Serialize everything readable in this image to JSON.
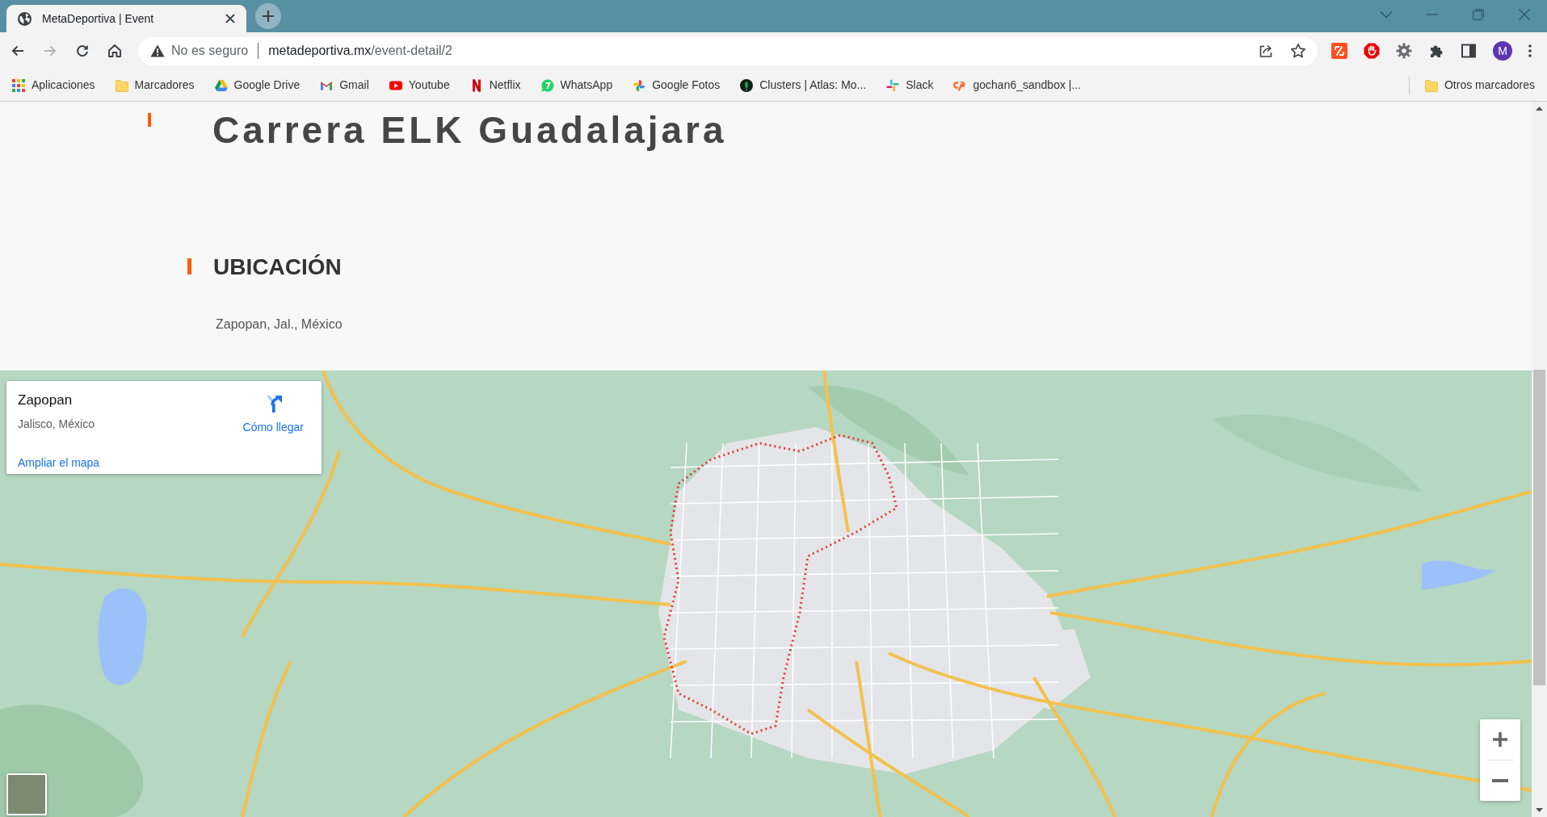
{
  "browser": {
    "tabs": [
      {
        "title": "MetaDeportiva | Event",
        "selected": true
      }
    ],
    "toolbar": {
      "nav": [
        {
          "kind": "back",
          "disabled": false
        },
        {
          "kind": "forward",
          "disabled": true
        },
        {
          "kind": "reload",
          "disabled": false
        },
        {
          "kind": "home",
          "disabled": false
        }
      ],
      "security_label": "No es seguro",
      "url_host": "metadeportiva.mx",
      "url_path": "/event-detail/2",
      "profile_initial": "M"
    },
    "bookmarks": [
      {
        "label": "Aplicaciones",
        "kind": "apps"
      },
      {
        "label": "Marcadores",
        "kind": "folder"
      },
      {
        "label": "Google Drive",
        "kind": "drive"
      },
      {
        "label": "Gmail",
        "kind": "mail"
      },
      {
        "label": "Youtube",
        "kind": "video"
      },
      {
        "label": "Netflix",
        "kind": "netflix"
      },
      {
        "label": "WhatsApp",
        "kind": "chat"
      },
      {
        "label": "Google Fotos",
        "kind": "pinwheel"
      },
      {
        "label": "Clusters | Atlas: Mo...",
        "kind": "leaf"
      },
      {
        "label": "Slack",
        "kind": "slack"
      },
      {
        "label": "gochan6_sandbox |...",
        "kind": "cpanel"
      }
    ],
    "other_bookmarks": {
      "label": "Otros marcadores",
      "kind": "folder"
    }
  },
  "page": {
    "title": "Carrera ELK Guadalajara",
    "section_title": "UBICACIÓN",
    "address": "Zapopan, Jal., México",
    "map": {
      "place_card": {
        "name": "Zapopan",
        "region": "Jalisco, México",
        "directions": "Cómo llegar",
        "enlarge": "Ampliar el mapa"
      }
    }
  }
}
